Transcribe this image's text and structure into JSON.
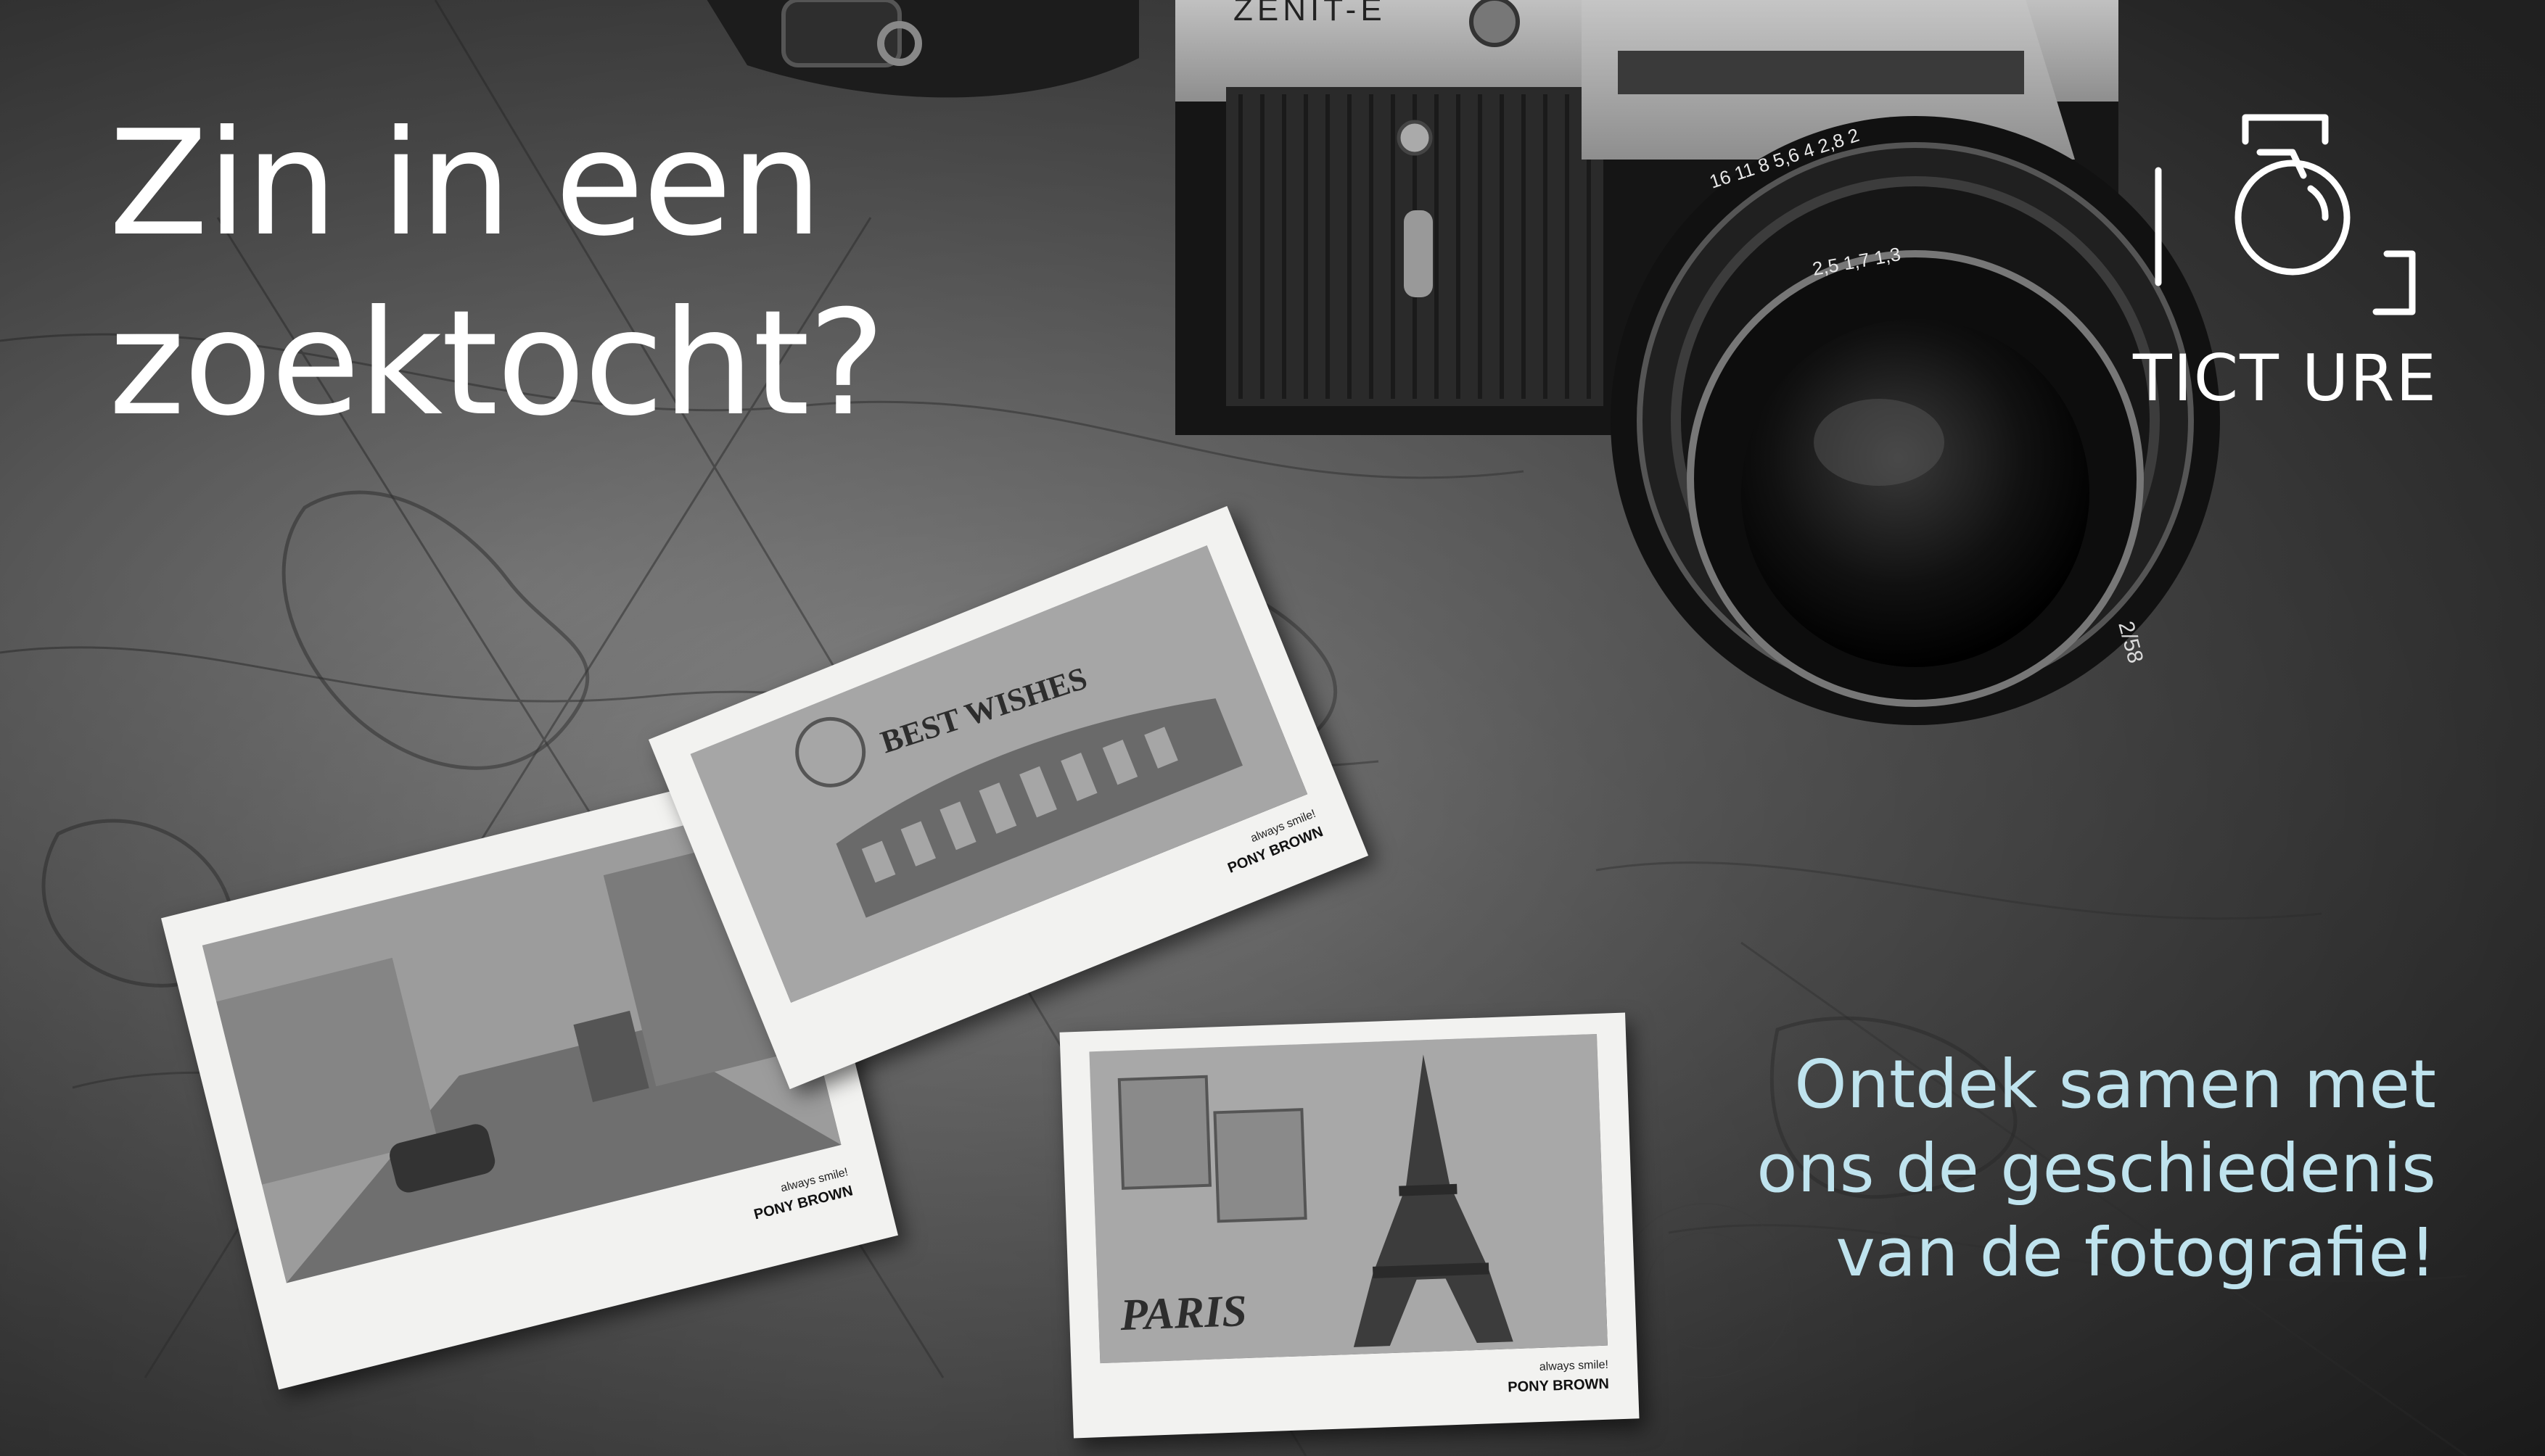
{
  "headline": {
    "line1": "Zin in een",
    "line2": "zoektocht?"
  },
  "tagline": {
    "line1": "Ontdek samen met",
    "line2": "ons de geschiedenis",
    "line3": "van de fotografie!"
  },
  "logo": {
    "text": "TICT URE",
    "icon": "camera-outline-icon"
  },
  "camera": {
    "brand": "ZENIT-E",
    "lens_marking": "2/58",
    "distance_scale": "16  11  8  5,6  4  2,8  2",
    "focus_scale": "2,5  1,7  1,3"
  },
  "polaroids": [
    {
      "photo_text": "",
      "caption_small": "always smile!",
      "caption_big": "PONY BROWN"
    },
    {
      "photo_text": "BEST WISHES",
      "caption_small": "always smile!",
      "caption_big": "PONY BROWN"
    },
    {
      "photo_text": "PARIS",
      "caption_small": "always smile!",
      "caption_big": "PONY BROWN"
    }
  ],
  "colors": {
    "headline": "#ffffff",
    "tagline": "#bfe3ee",
    "logo": "#ffffff"
  }
}
